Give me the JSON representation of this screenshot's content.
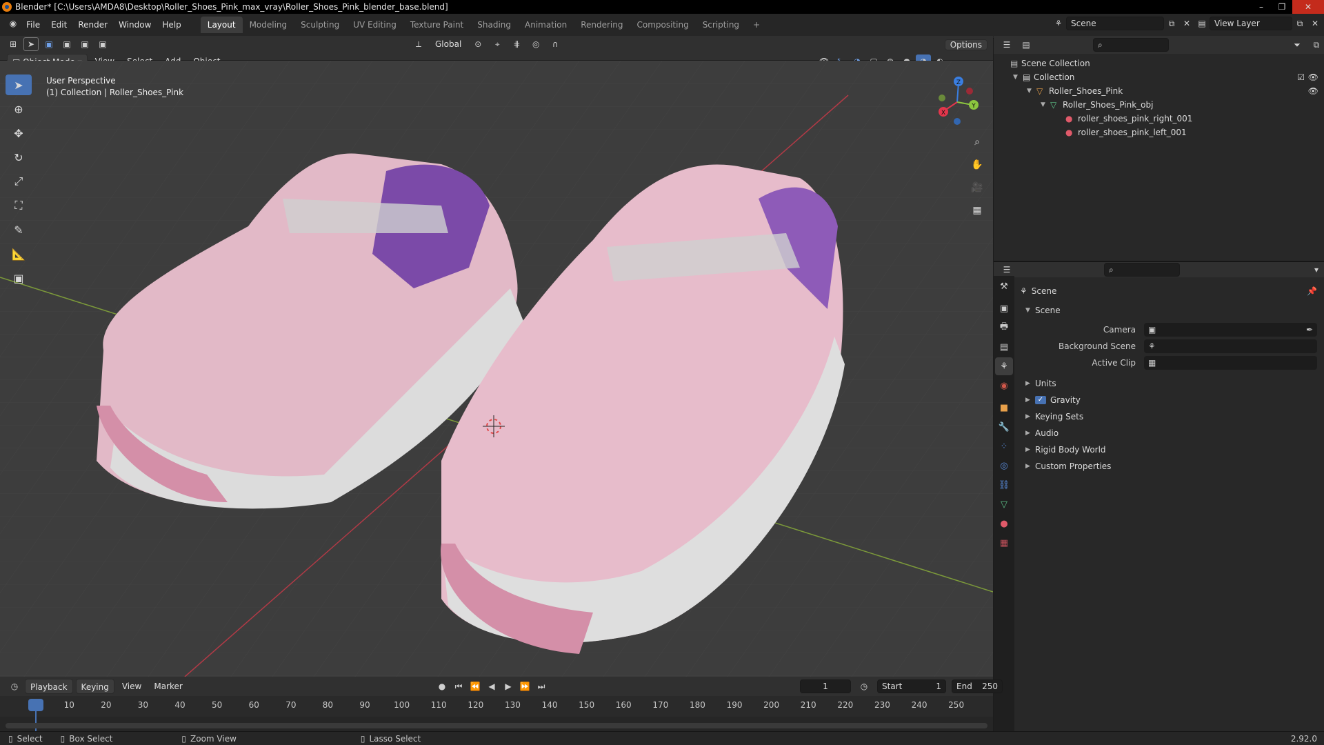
{
  "title_bar": {
    "text": "Blender* [C:\\Users\\AMDA8\\Desktop\\Roller_Shoes_Pink_max_vray\\Roller_Shoes_Pink_blender_base.blend]",
    "min": "–",
    "max": "❐",
    "close": "✕"
  },
  "menu": {
    "file": "File",
    "edit": "Edit",
    "render": "Render",
    "window": "Window",
    "help": "Help"
  },
  "workspaces": [
    "Layout",
    "Modeling",
    "Sculpting",
    "UV Editing",
    "Texture Paint",
    "Shading",
    "Animation",
    "Rendering",
    "Compositing",
    "Scripting"
  ],
  "add_tab": "+",
  "scene_field": "Scene",
  "view_layer_field": "View Layer",
  "viewport_header": {
    "mode": "Object Mode",
    "view": "View",
    "select": "Select",
    "add": "Add",
    "object": "Object",
    "orientation": "Global",
    "options": "Options"
  },
  "viewport": {
    "perspective": "User Perspective",
    "collection_info": "(1) Collection | Roller_Shoes_Pink"
  },
  "gizmo": {
    "x": "X",
    "y": "Y",
    "z": "Z"
  },
  "outliner": {
    "rows": [
      {
        "label": "Scene Collection"
      },
      {
        "label": "Collection"
      },
      {
        "label": "Roller_Shoes_Pink"
      },
      {
        "label": "Roller_Shoes_Pink_obj"
      },
      {
        "label": "roller_shoes_pink_right_001"
      },
      {
        "label": "roller_shoes_pink_left_001"
      }
    ]
  },
  "properties": {
    "context_label": "Scene",
    "section": "Scene",
    "camera_label": "Camera",
    "background_label": "Background Scene",
    "clip_label": "Active Clip",
    "panels": [
      "Units",
      "Gravity",
      "Keying Sets",
      "Audio",
      "Rigid Body World",
      "Custom Properties"
    ]
  },
  "timeline": {
    "playback": "Playback",
    "keying": "Keying",
    "view": "View",
    "marker": "Marker",
    "current_frame": "1",
    "start_label": "Start",
    "start_value": "1",
    "end_label": "End",
    "end_value": "250",
    "ticks": [
      "1",
      "10",
      "20",
      "30",
      "40",
      "50",
      "60",
      "70",
      "80",
      "90",
      "100",
      "110",
      "120",
      "130",
      "140",
      "150",
      "160",
      "170",
      "180",
      "190",
      "200",
      "210",
      "220",
      "230",
      "240",
      "250"
    ]
  },
  "status": {
    "select": "Select",
    "box_select": "Box Select",
    "zoom_view": "Zoom View",
    "lasso_select": "Lasso Select",
    "version": "2.92.0"
  },
  "colors": {
    "accent": "#4772b3",
    "x_axis": "#e3364c",
    "y_axis": "#8cc63f",
    "z_axis": "#3a7ee0",
    "shoe": "#e7bccb"
  }
}
